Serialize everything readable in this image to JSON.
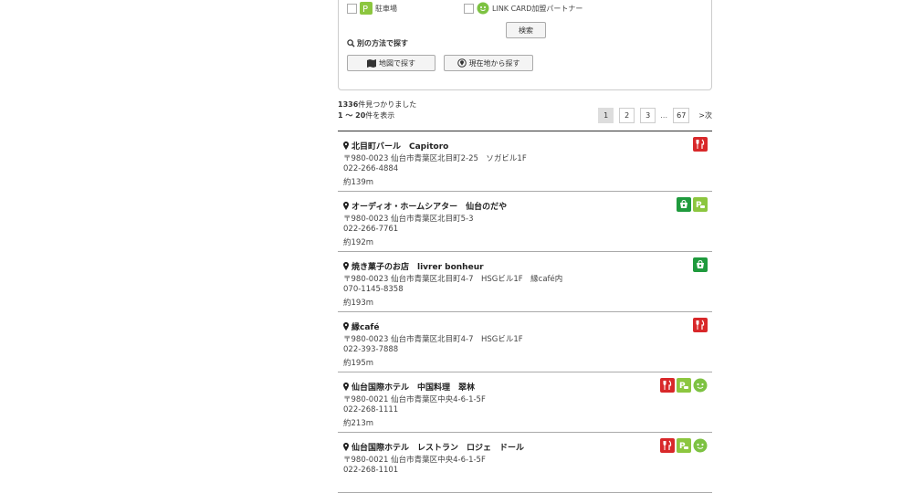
{
  "filters": {
    "parking_label": "駐車場",
    "link_card_label": "LINK CARD加盟パートナー"
  },
  "search_button": "検索",
  "alt_search_label": "別の方法で探す",
  "map_search_button": "地図で探す",
  "location_search_button": "現在地から探す",
  "results": {
    "found_count": "1336",
    "found_suffix": "件見つかりました",
    "range_text": "1 〜 20",
    "range_suffix": "件を表示"
  },
  "pagination": {
    "pages": [
      "1",
      "2",
      "3",
      "67"
    ],
    "ellipsis": "…",
    "next_label": ">次",
    "current": "1"
  },
  "shops": [
    {
      "name": "北目町バール　Capitoro",
      "address": "〒980-0023 仙台市青葉区北目町2-25　ソガビル1F",
      "phone": "022-266-4884",
      "distance": "約139m",
      "icons": [
        "food-icon"
      ]
    },
    {
      "name": "オーディオ・ホームシアター　仙台のだや",
      "address": "〒980-0023 仙台市青葉区北目町5-3",
      "phone": "022-266-7761",
      "distance": "約192m",
      "icons": [
        "shopping-icon",
        "parking-icon"
      ]
    },
    {
      "name": "焼き菓子のお店　livrer bonheur",
      "address": "〒980-0023 仙台市青葉区北目町4-7　HSGビル1F　縁café内",
      "phone": "070-1145-8358",
      "distance": "約193m",
      "icons": [
        "shopping-icon"
      ]
    },
    {
      "name": "縁café",
      "address": "〒980-0023 仙台市青葉区北目町4-7　HSGビル1F",
      "phone": "022-393-7888",
      "distance": "約195m",
      "icons": [
        "food-icon"
      ]
    },
    {
      "name": "仙台国際ホテル　中国料理　翠林",
      "address": "〒980-0021 仙台市青葉区中央4-6-1-5F",
      "phone": "022-268-1111",
      "distance": "約213m",
      "icons": [
        "food-icon",
        "parking-icon",
        "link-card-icon"
      ]
    },
    {
      "name": "仙台国際ホテル　レストラン　ロジェ　ドール",
      "address": "〒980-0021 仙台市青葉区中央4-6-1-5F",
      "phone": "022-268-1101",
      "distance": "",
      "icons": [
        "food-icon",
        "parking-icon",
        "link-card-icon"
      ]
    }
  ],
  "colors": {
    "food": "#d8282a",
    "shopping": "#1f9a3d",
    "parking": "#8cc63f",
    "link_card": "#7dc242"
  }
}
